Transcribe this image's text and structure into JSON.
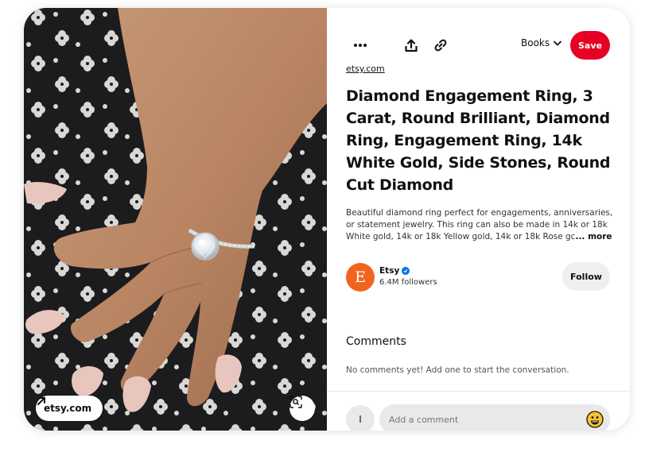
{
  "image": {
    "source_chip_label": "etsy.com",
    "icons": {
      "source_arrow": "arrow-up-right-icon",
      "visual_search": "visual-search-icon"
    }
  },
  "toolbar": {
    "more_icon": "more-icon",
    "share_icon": "share-icon",
    "link_icon": "link-icon",
    "board_label": "Books",
    "save_label": "Save"
  },
  "pin": {
    "source": "etsy.com",
    "title": "Diamond Engagement Ring, 3 Carat, Round Brilliant, Diamond Ring, Engagement Ring, 14k White Gold, Side Stones, Round Cut Diamond",
    "description": "Beautiful diamond ring perfect for engagements, anniversaries, or statement jewelry. This ring can also be made in 14k or 18k White gold, 14k or 18k Yellow gold, 14k or 18k Rose gc",
    "more_label": "... more"
  },
  "creator": {
    "initial": "E",
    "name": "Etsy",
    "followers": "6.4M followers",
    "follow_label": "Follow"
  },
  "comments": {
    "heading": "Comments",
    "empty_text": "No comments yet! Add one to start the conversation.",
    "user_initial": "I",
    "placeholder": "Add a comment"
  },
  "colors": {
    "save_red": "#e60023",
    "etsy_orange": "#f1641e",
    "verified_blue": "#0074e8"
  }
}
